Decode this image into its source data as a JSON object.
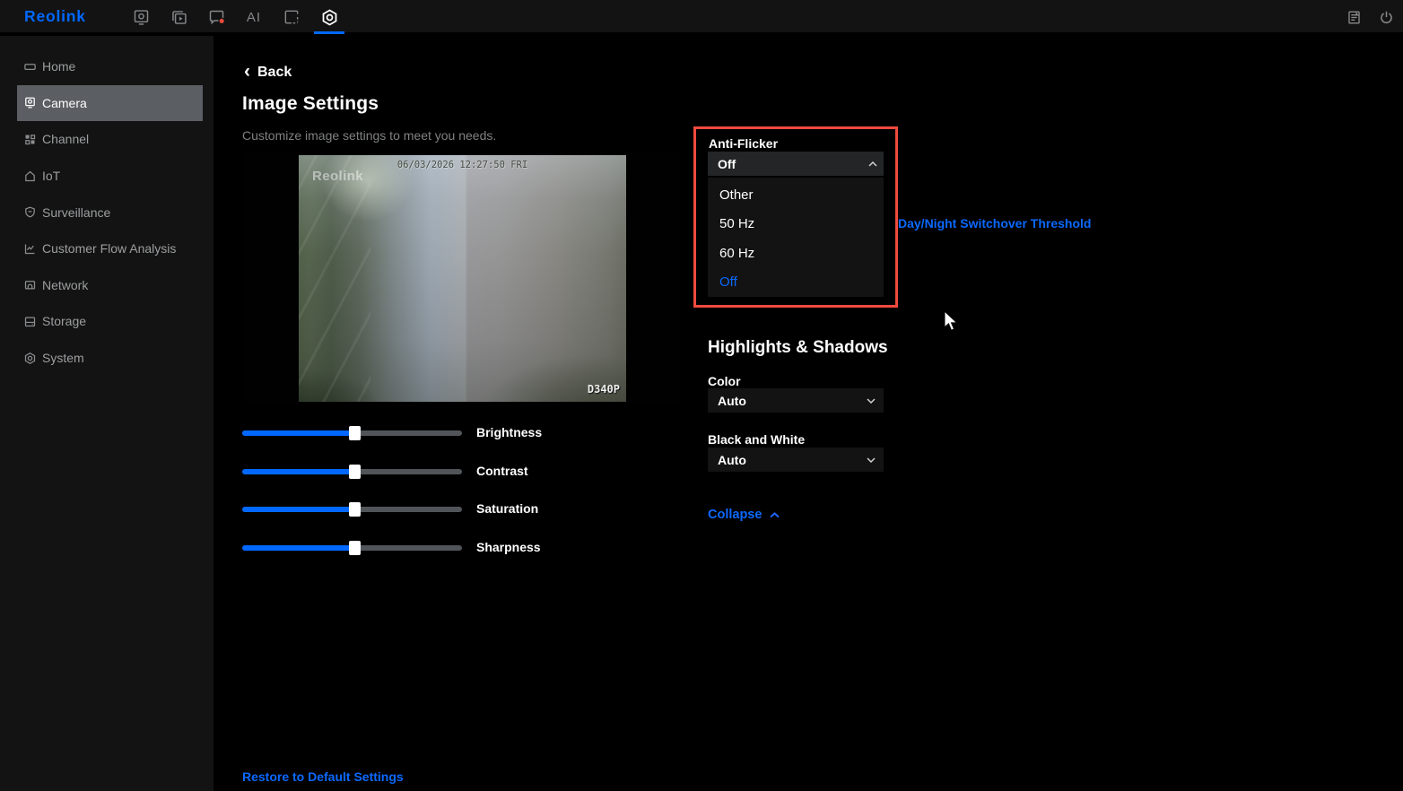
{
  "topbar": {
    "logo_text": "Reolink",
    "ai_label": "AI"
  },
  "sidebar": {
    "items": [
      {
        "label": "Home",
        "selected": false
      },
      {
        "label": "Camera",
        "selected": true
      },
      {
        "label": "Channel",
        "selected": false
      },
      {
        "label": "IoT",
        "selected": false
      },
      {
        "label": "Surveillance",
        "selected": false
      },
      {
        "label": "Customer Flow Analysis",
        "selected": false
      },
      {
        "label": "Network",
        "selected": false
      },
      {
        "label": "Storage",
        "selected": false
      },
      {
        "label": "System",
        "selected": false
      }
    ]
  },
  "main": {
    "back_label": "Back",
    "title": "Image Settings",
    "subtitle": "Customize image settings to meet you needs.",
    "preview": {
      "watermark": "Reolink",
      "timestamp": "06/03/2026 12:27:50 FRI",
      "model_label": "D340P"
    },
    "sliders": [
      {
        "label": "Brightness",
        "value_pct": 51
      },
      {
        "label": "Contrast",
        "value_pct": 51
      },
      {
        "label": "Saturation",
        "value_pct": 51
      },
      {
        "label": "Sharpness",
        "value_pct": 51
      }
    ],
    "restore_label": "Restore to Default Settings"
  },
  "anti_flicker": {
    "label": "Anti-Flicker",
    "value": "Off",
    "options": [
      {
        "label": "Other",
        "selected": false
      },
      {
        "label": "50 Hz",
        "selected": false
      },
      {
        "label": "60 Hz",
        "selected": false
      },
      {
        "label": "Off",
        "selected": true
      }
    ]
  },
  "links": {
    "day_night": "Day/Night Switchover Threshold",
    "collapse": "Collapse"
  },
  "highlights_shadows": {
    "title": "Highlights & Shadows",
    "color_label": "Color",
    "color_value": "Auto",
    "bw_label": "Black and White",
    "bw_value": "Auto"
  },
  "colors": {
    "accent_blue": "#0068ff",
    "link_blue": "#1e66fd",
    "highlight_red": "#f04a3e",
    "topbar_bg": "#131313",
    "content_bg": "#000000"
  }
}
